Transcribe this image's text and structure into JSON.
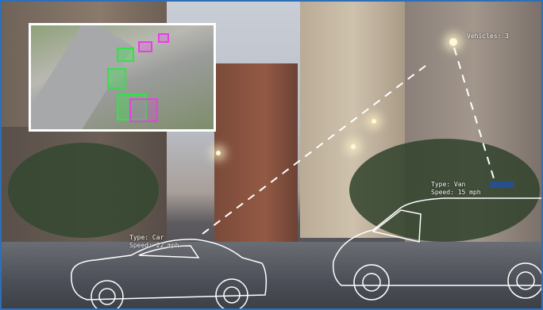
{
  "hud": {
    "vehicles_count": "Vehicles: 3",
    "van_type": "Type: Van",
    "van_speed": "Speed: 15 mph",
    "car_type": "Type: Car",
    "car_speed": "Speed: 22 mph"
  },
  "colors": {
    "detection_green": "#35e04a",
    "detection_magenta": "#e640e6",
    "outline": "#ffffff",
    "frame": "#2e6fb7"
  },
  "icons": {
    "camera_inset": "traffic-camera-feed",
    "car_outline": "sedan-outline-icon",
    "van_outline": "van-outline-icon"
  }
}
